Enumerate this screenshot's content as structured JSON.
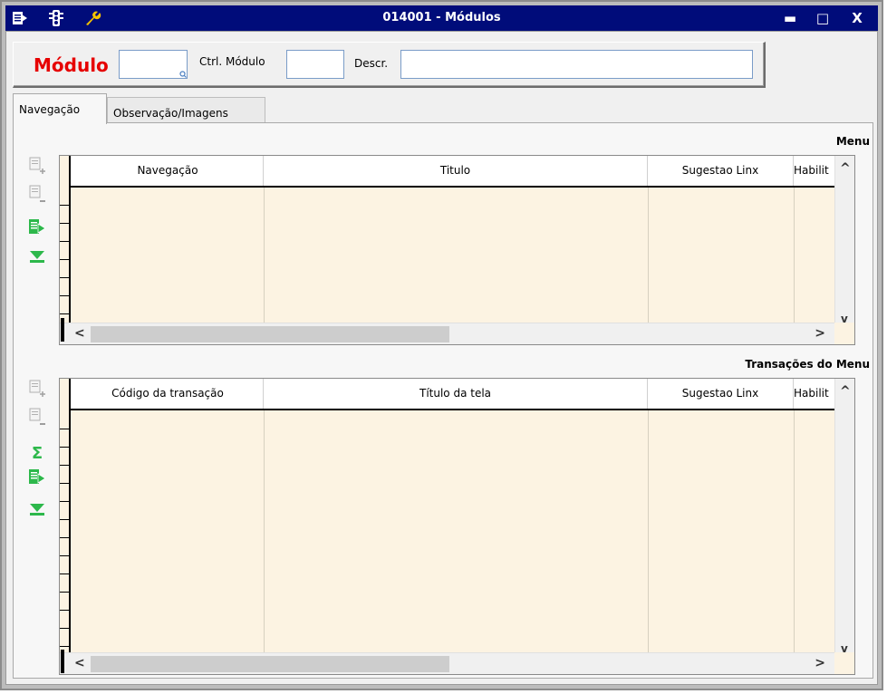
{
  "window": {
    "title": "014001 - Módulos"
  },
  "titlebar_icons": [
    "menu-icon",
    "traffic-light-icon",
    "wrench-icon"
  ],
  "window_buttons": {
    "minimize": "▬",
    "maximize": "□",
    "close": "X"
  },
  "filter": {
    "modulo_label": "Módulo",
    "modulo_value": "",
    "ctrl_modulo_label": "Ctrl. Módulo",
    "ctrl_modulo_value": "",
    "descr_label": "Descr.",
    "descr_value": ""
  },
  "tabs": [
    {
      "label": "Navegação",
      "active": true
    },
    {
      "label": "Observação/Imagens",
      "active": false
    }
  ],
  "menu_section": {
    "title": "Menu",
    "columns": [
      "Navegação",
      "Titulo",
      "Sugestao Linx",
      "Habilit"
    ]
  },
  "transactions_section": {
    "title": "Transações do Menu",
    "columns": [
      "Código da transação",
      "Título da tela",
      "Sugestao Linx",
      "Habilit"
    ]
  },
  "scroll": {
    "up": "^",
    "down": "v",
    "left": "<",
    "right": ">"
  },
  "colors": {
    "titlebar": "#000c7a",
    "grid_bg": "#fcf3e2",
    "modulo_label": "#e60000",
    "icon_green": "#2db84b"
  }
}
